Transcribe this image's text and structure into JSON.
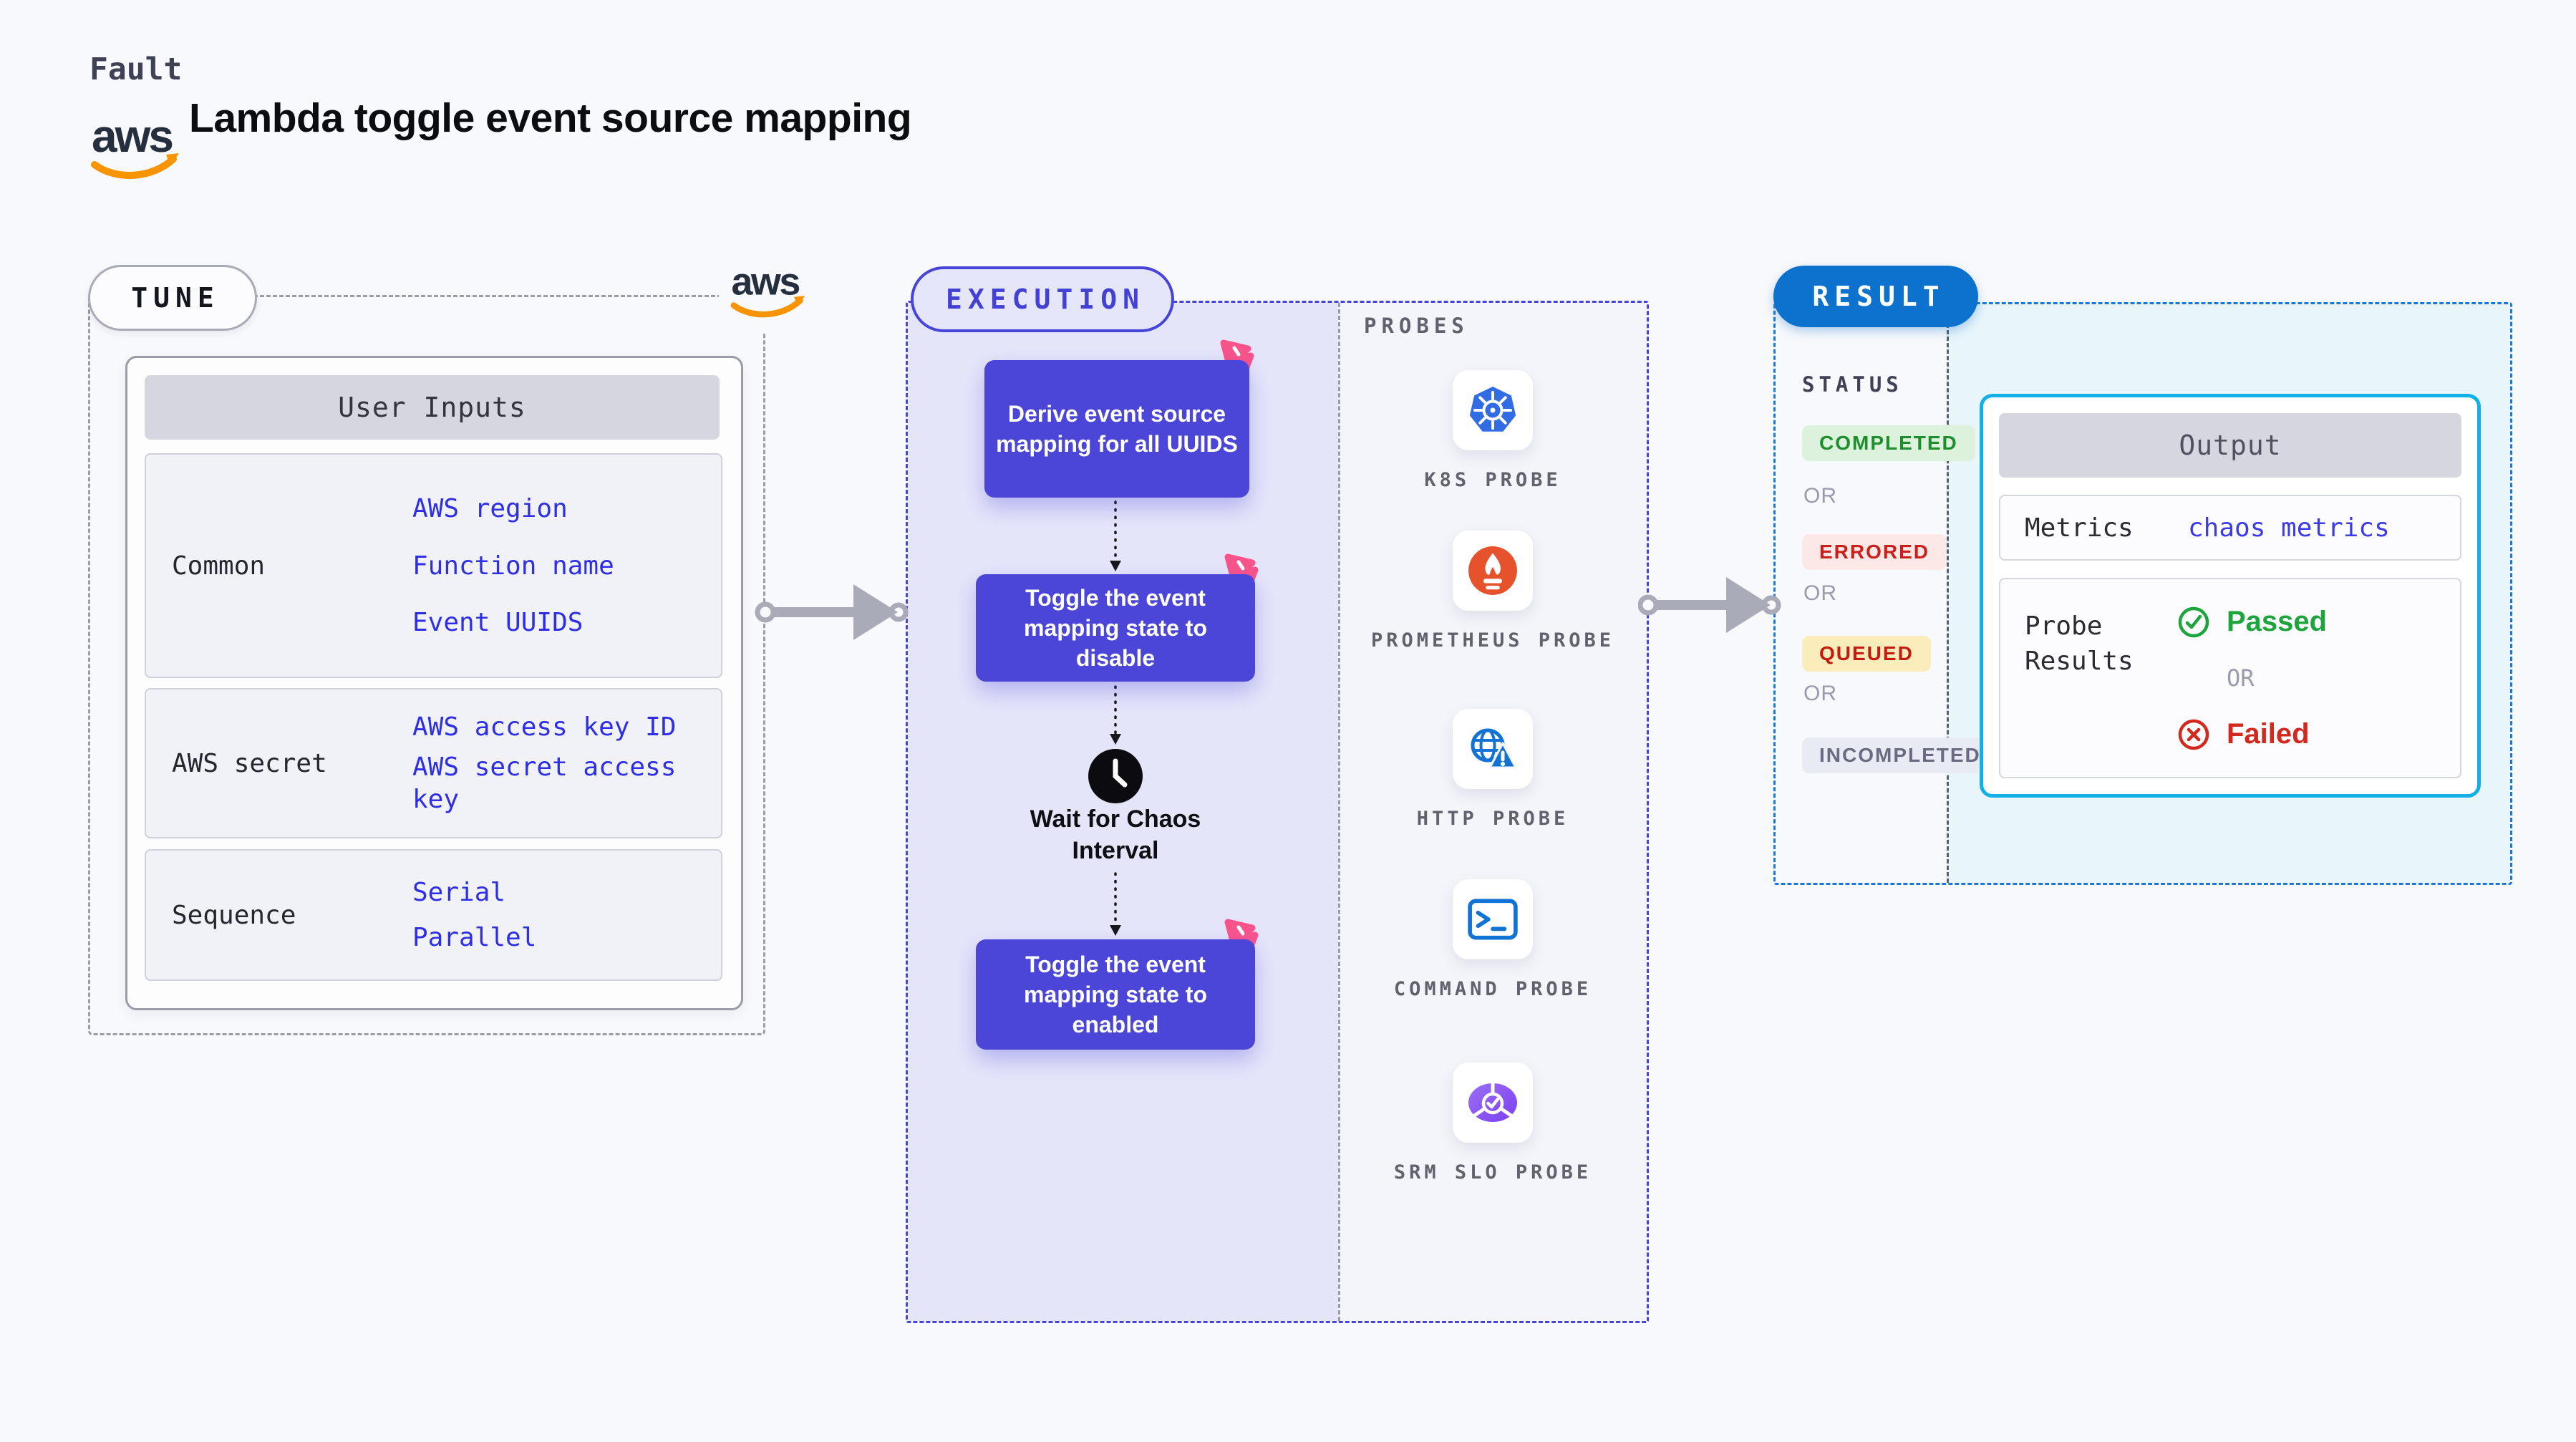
{
  "header": {
    "kicker": "Fault",
    "title": "Lambda toggle event source mapping",
    "aws_wordmark": "aws"
  },
  "tune": {
    "pill_label": "TUNE",
    "table_header": "User Inputs",
    "rows": [
      {
        "label": "Common",
        "links": [
          "AWS region",
          "Function name",
          "Event UUIDS"
        ]
      },
      {
        "label": "AWS secret",
        "links": [
          "AWS access key ID",
          "AWS secret access key"
        ]
      },
      {
        "label": "Sequence",
        "links": [
          "Serial",
          "Parallel"
        ]
      }
    ]
  },
  "execution": {
    "pill_label": "EXECUTION",
    "nodes": [
      {
        "label": "Derive event source mapping for all UUIDS"
      },
      {
        "label": "Toggle the event mapping state to disable"
      },
      {
        "label": "Toggle the event mapping state to enabled"
      }
    ],
    "wait_step_label": "Wait for Chaos Interval",
    "probes": {
      "title": "PROBES",
      "items": [
        {
          "label": "K8S PROBE",
          "icon": "kubernetes-icon"
        },
        {
          "label": "PROMETHEUS PROBE",
          "icon": "prometheus-icon"
        },
        {
          "label": "HTTP PROBE",
          "icon": "http-globe-warning-icon"
        },
        {
          "label": "COMMAND PROBE",
          "icon": "terminal-icon"
        },
        {
          "label": "SRM SLO PROBE",
          "icon": "srm-slo-gauge-icon"
        }
      ]
    }
  },
  "result": {
    "pill_label": "RESULT",
    "status_title": "STATUS",
    "or_label": "OR",
    "statuses": [
      {
        "label": "COMPLETED",
        "text_color": "#1e8e2c",
        "bg_color": "#ddf2dc"
      },
      {
        "label": "ERRORED",
        "text_color": "#cb1f1c",
        "bg_color": "#fce9e7"
      },
      {
        "label": "QUEUED",
        "text_color": "#c41a10",
        "bg_color": "#fbedbb"
      },
      {
        "label": "INCOMPLETED",
        "text_color": "#6a6a80",
        "bg_color": "#e8eaf4"
      }
    ],
    "output": {
      "header": "Output",
      "metrics_label": "Metrics",
      "metrics_value": "chaos metrics",
      "probe_results_label": "Probe Results",
      "passed_label": "Passed",
      "or_label": "OR",
      "failed_label": "Failed"
    }
  },
  "colors": {
    "page_bg": "#f8f9fc",
    "node_indigo": "#4b46d8",
    "execution_border": "#4745d8",
    "execution_bg": "#e5e5fa",
    "link_blue": "#2e2ee4",
    "result_pill_bg": "#0d72cd",
    "result_border": "#1e78d2",
    "result_bg": "#e8f5fb",
    "output_border": "#10b0e8",
    "chaos_pink": "#f8548b",
    "kubernetes_blue": "#326ce5",
    "prometheus_orange": "#e6522c",
    "probe_icon_blue": "#1273d4",
    "aws_orange": "#f79400",
    "passed_green": "#1ea43c",
    "failed_red": "#d3281e",
    "arrow_gray": "#a9abb8"
  }
}
